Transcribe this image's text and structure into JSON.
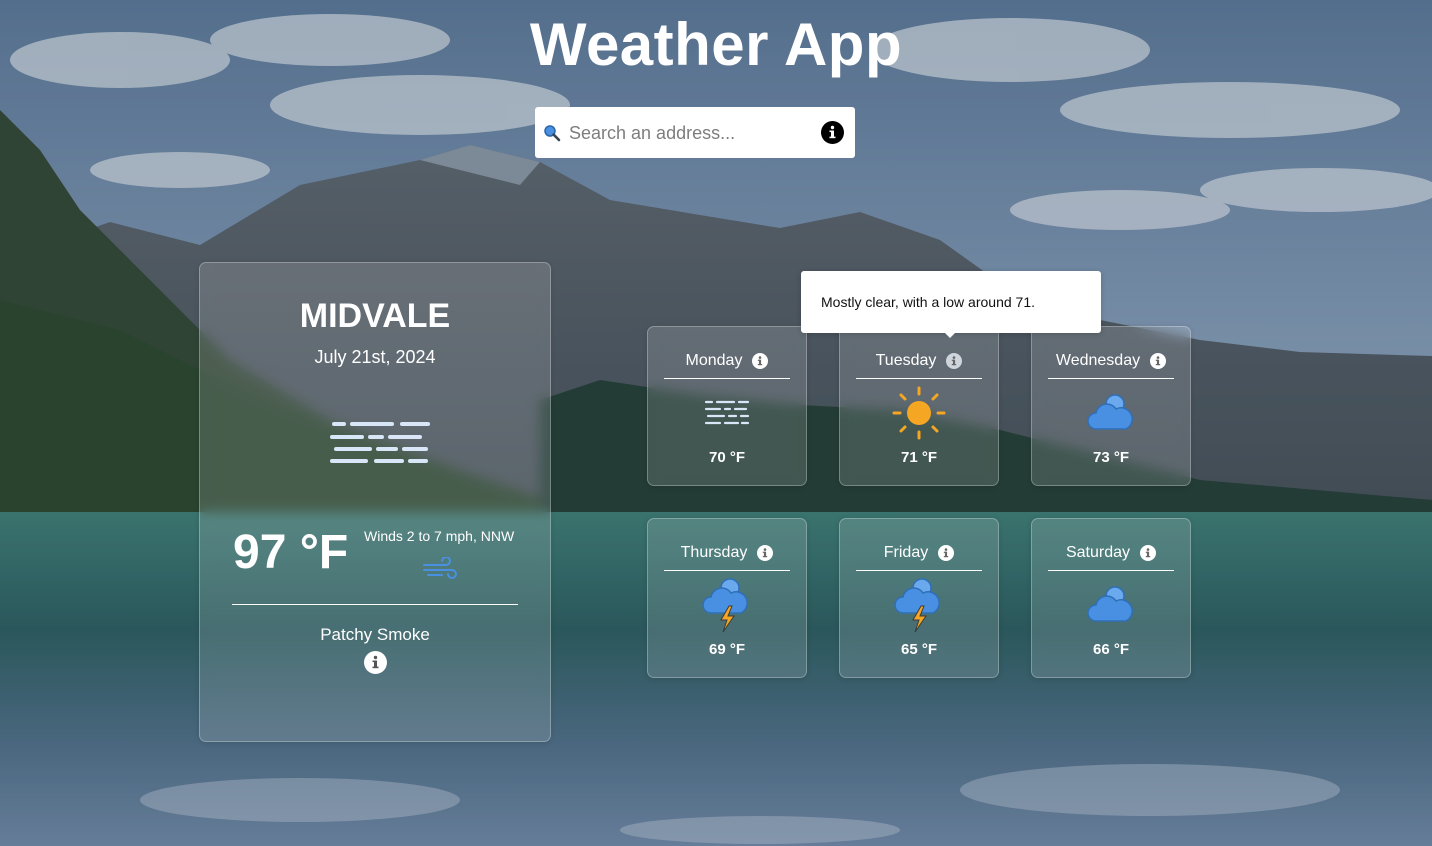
{
  "app": {
    "title": "Weather App"
  },
  "search": {
    "placeholder": "Search an address..."
  },
  "current": {
    "city": "MIDVALE",
    "date": "July 21st, 2024",
    "temperature": "97 °F",
    "wind": "Winds 2 to 7 mph, NNW",
    "condition": "Patchy Smoke",
    "icon": "smoke-icon"
  },
  "tooltip": {
    "text": "Mostly clear, with a low around 71."
  },
  "forecast": [
    {
      "day": "Monday",
      "temp": "70 °F",
      "icon": "smoke-icon"
    },
    {
      "day": "Tuesday",
      "temp": "71 °F",
      "icon": "sun-icon"
    },
    {
      "day": "Wednesday",
      "temp": "73 °F",
      "icon": "cloud-icon"
    },
    {
      "day": "Thursday",
      "temp": "69 °F",
      "icon": "thunderstorm-icon"
    },
    {
      "day": "Friday",
      "temp": "65 °F",
      "icon": "thunderstorm-icon"
    },
    {
      "day": "Saturday",
      "temp": "66 °F",
      "icon": "cloud-icon"
    }
  ],
  "colors": {
    "icon_blue": "#4a90e2",
    "sun_orange": "#f5a623",
    "smoke_lines": "#d8e6f8",
    "card_glass": "rgba(255,255,255,0.14)"
  }
}
